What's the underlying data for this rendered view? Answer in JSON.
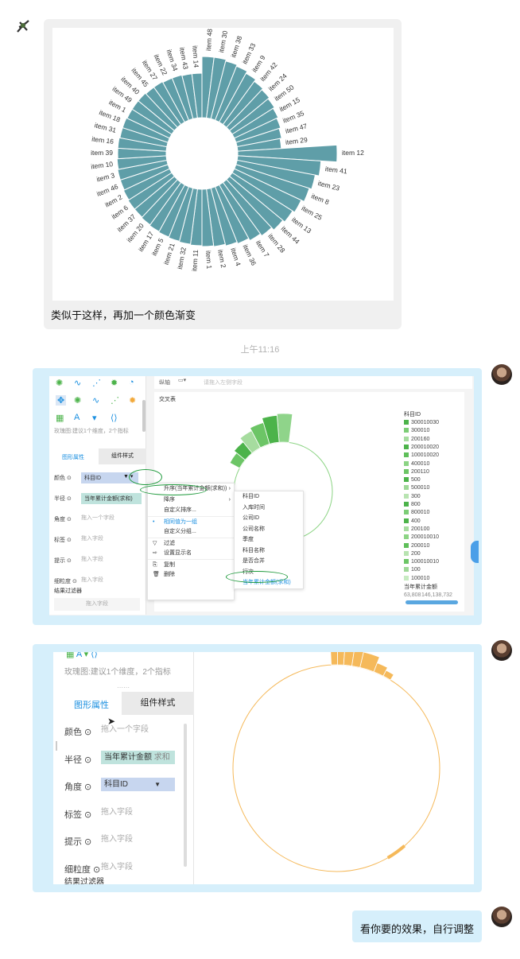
{
  "messages": [
    {
      "sender": "other",
      "caption": "类似于这样，再加一个颜色渐变"
    },
    {
      "timestamp": "上午11:16"
    },
    {
      "sender": "me",
      "type": "screenshot-rose-dialog"
    },
    {
      "sender": "me",
      "type": "screenshot-rose-config"
    },
    {
      "sender": "me",
      "text": "看你要的效果，自行调整"
    }
  ],
  "rose_chart_labels": [
    "item 48",
    "item 30",
    "item 38",
    "item 33",
    "item 9",
    "item 42",
    "item 24",
    "item 50",
    "item 15",
    "item 35",
    "item 47",
    "item 29",
    "item 12",
    "item 41",
    "item 23",
    "item 8",
    "item 25",
    "item 13",
    "item 44",
    "item 28",
    "item 7",
    "item 36",
    "item 4",
    "item 2",
    "item 1",
    "item 11",
    "item 32",
    "item 21",
    "item 5",
    "item 17",
    "item 20",
    "item 37",
    "item 6",
    "item 2",
    "item 46",
    "item 3",
    "item 10",
    "item 39",
    "item 16",
    "item 31",
    "item 18",
    "item 1",
    "item 49",
    "item 40",
    "item 45",
    "item 27",
    "item 22",
    "item 34",
    "item 43",
    "item 14"
  ],
  "screenshot1": {
    "toolbar_label": "纵轴",
    "toolbar_placeholder": "请拖入左侧字段",
    "hint": "玫瑰图:建议1个维度，2个指标",
    "tab_graphic": "图形属性",
    "tab_component": "组件样式",
    "rows": [
      {
        "label": "颜色",
        "value": "科目ID"
      },
      {
        "label": "半径",
        "value": "当年累计金额(求和)"
      },
      {
        "label": "角度",
        "value": "拖入一个字段"
      },
      {
        "label": "标签",
        "value": "拖入字段"
      },
      {
        "label": "提示",
        "value": "拖入字段"
      },
      {
        "label": "细粒度",
        "value": "拖入字段"
      }
    ],
    "filter_label": "结果过滤器",
    "filter_placeholder": "拖入字段",
    "sheet_title": "交叉表",
    "context_menu": [
      "升序(当年累计金额(求和))",
      "降序",
      "自定义排序...",
      "相同值为一组",
      "自定义分组...",
      "过滤",
      "设置显示名",
      "复制",
      "删除"
    ],
    "submenu": [
      "科目ID",
      "入库时间",
      "公司ID",
      "公司名称",
      "季度",
      "科目名称",
      "是否合并",
      "行次",
      "当年累计金额(求和)"
    ],
    "legend_title": "科目ID",
    "legend_items": [
      "300010030",
      "300010",
      "200160",
      "200010020",
      "100010020",
      "400010",
      "200110",
      "500",
      "500010",
      "300",
      "800",
      "800010",
      "400",
      "200100",
      "200010010",
      "200010",
      "200",
      "100010010",
      "100",
      "100010"
    ],
    "legend_colors": [
      "#4cb34a",
      "#7ccd76",
      "#a6dc9f",
      "#4cb34a",
      "#5fbf5a",
      "#8cd484",
      "#6cc566",
      "#4cb34a",
      "#9fd898",
      "#b8e4b1",
      "#4cb34a",
      "#7ccd76",
      "#4cb34a",
      "#a6dc9f",
      "#8cd484",
      "#5fbf5a",
      "#b8e4b1",
      "#6cc566",
      "#9fd898",
      "#c7ebc1"
    ],
    "size_title": "当年累计金额",
    "size_min": "63,808",
    "size_max": "146,138,732"
  },
  "screenshot2": {
    "hint": "玫瑰图:建议1个维度，2个指标",
    "tab_graphic": "图形属性",
    "tab_component": "组件样式",
    "rows": [
      {
        "label": "颜色",
        "value": "拖入一个字段"
      },
      {
        "label": "半径",
        "value": "当年累计金额",
        "agg": "求和"
      },
      {
        "label": "角度",
        "value": "科目ID"
      },
      {
        "label": "标签",
        "value": "拖入字段"
      },
      {
        "label": "提示",
        "value": "拖入字段"
      },
      {
        "label": "细粒度",
        "value": "拖入字段"
      }
    ],
    "filter_label": "结果过滤器"
  },
  "colors": {
    "teal": "#5f9ea8",
    "green": "#4cb34a",
    "orange": "#f5b95a",
    "bubble_blue": "#d6effb",
    "accent_blue": "#1a8fe0"
  }
}
